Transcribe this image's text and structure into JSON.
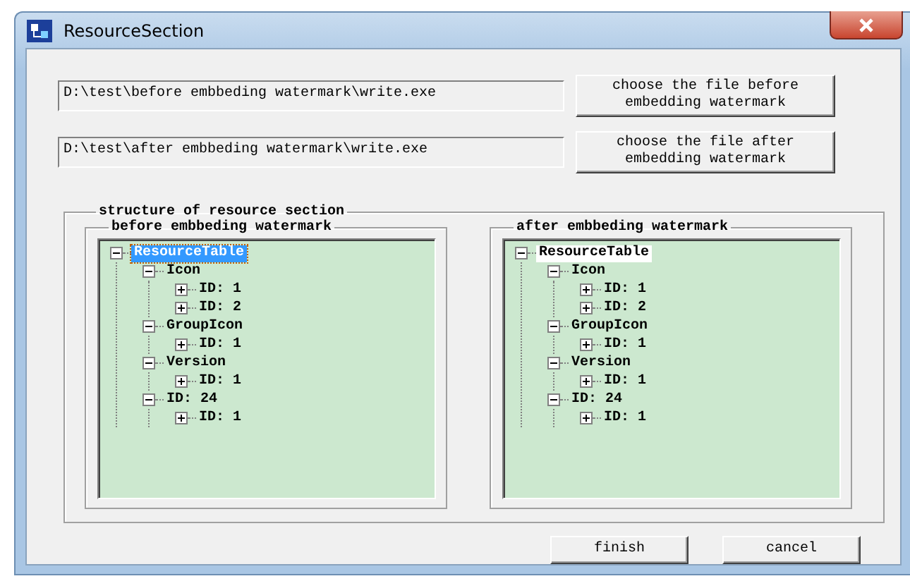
{
  "window": {
    "title": "ResourceSection"
  },
  "files": [
    {
      "value": "D:\\test\\before embbeding watermark\\write.exe",
      "button": "choose the file before embedding watermark"
    },
    {
      "value": "D:\\test\\after embbeding watermark\\write.exe",
      "button": "choose the file after embedding watermark"
    }
  ],
  "structure": {
    "title": "structure of resource section",
    "panels": [
      {
        "title": "before embbeding watermark",
        "focused": true,
        "tree": [
          {
            "label": "ResourceTable",
            "expanded": true,
            "selected": true,
            "children": [
              {
                "label": "Icon",
                "expanded": true,
                "selected": false,
                "children": [
                  {
                    "label": "ID: 1",
                    "expanded": false,
                    "selected": false
                  },
                  {
                    "label": "ID: 2",
                    "expanded": false,
                    "selected": false
                  }
                ]
              },
              {
                "label": "GroupIcon",
                "expanded": true,
                "selected": false,
                "children": [
                  {
                    "label": "ID: 1",
                    "expanded": false,
                    "selected": false
                  }
                ]
              },
              {
                "label": "Version",
                "expanded": true,
                "selected": false,
                "children": [
                  {
                    "label": "ID: 1",
                    "expanded": false,
                    "selected": false
                  }
                ]
              },
              {
                "label": "ID: 24",
                "expanded": true,
                "selected": false,
                "children": [
                  {
                    "label": "ID: 1",
                    "expanded": false,
                    "selected": false
                  }
                ]
              }
            ]
          }
        ]
      },
      {
        "title": "after embbeding watermark",
        "focused": false,
        "tree": [
          {
            "label": "ResourceTable",
            "expanded": true,
            "selected": true,
            "children": [
              {
                "label": "Icon",
                "expanded": true,
                "selected": false,
                "children": [
                  {
                    "label": "ID: 1",
                    "expanded": false,
                    "selected": false
                  },
                  {
                    "label": "ID: 2",
                    "expanded": false,
                    "selected": false
                  }
                ]
              },
              {
                "label": "GroupIcon",
                "expanded": true,
                "selected": false,
                "children": [
                  {
                    "label": "ID: 1",
                    "expanded": false,
                    "selected": false
                  }
                ]
              },
              {
                "label": "Version",
                "expanded": true,
                "selected": false,
                "children": [
                  {
                    "label": "ID: 1",
                    "expanded": false,
                    "selected": false
                  }
                ]
              },
              {
                "label": "ID: 24",
                "expanded": true,
                "selected": false,
                "children": [
                  {
                    "label": "ID: 1",
                    "expanded": false,
                    "selected": false
                  }
                ]
              }
            ]
          }
        ]
      }
    ]
  },
  "buttons": [
    "finish",
    "cancel"
  ]
}
